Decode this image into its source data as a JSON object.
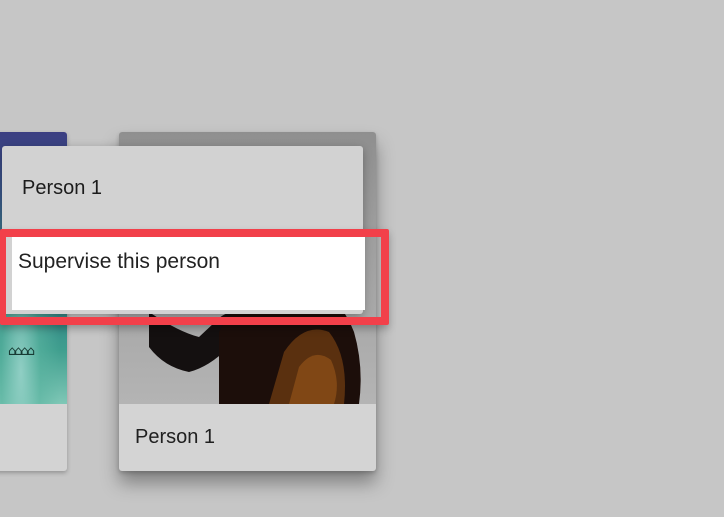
{
  "cards": {
    "main": {
      "name": "Person 1"
    }
  },
  "context_menu": {
    "header": "Person 1",
    "items": [
      {
        "label": "Supervise this person",
        "highlighted": true
      }
    ]
  },
  "colors": {
    "background": "#c6c6c6",
    "menu": "#d2d2d2",
    "menu_item_selected": "#ffffff",
    "highlight_border": "#f2404a"
  }
}
